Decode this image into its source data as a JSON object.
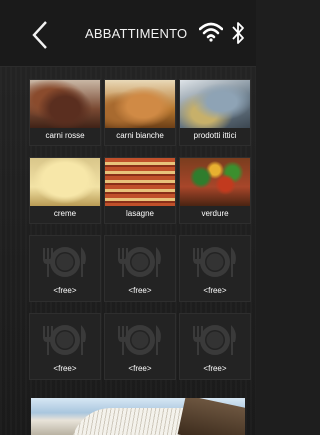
{
  "header": {
    "title": "ABBATTIMENTO",
    "back_icon": "chevron-left-icon",
    "wifi_icon": "wifi-icon",
    "bluetooth_icon": "bluetooth-icon"
  },
  "recipes": [
    {
      "label": "carni rosse",
      "image": "red-meat"
    },
    {
      "label": "carni bianche",
      "image": "roast-chicken"
    },
    {
      "label": "prodotti ittici",
      "image": "fish"
    },
    {
      "label": "creme",
      "image": "cream"
    },
    {
      "label": "lasagne",
      "image": "lasagna"
    },
    {
      "label": "verdure",
      "image": "vegetables"
    },
    {
      "label": "<free>",
      "image": "plate-cutlery-icon"
    },
    {
      "label": "<free>",
      "image": "plate-cutlery-icon"
    },
    {
      "label": "<free>",
      "image": "plate-cutlery-icon"
    },
    {
      "label": "<free>",
      "image": "plate-cutlery-icon"
    },
    {
      "label": "<free>",
      "image": "plate-cutlery-icon"
    },
    {
      "label": "<free>",
      "image": "plate-cutlery-icon"
    }
  ],
  "colors": {
    "background": "#1e1e1e",
    "header": "#1a1a1a",
    "text": "#ffffff"
  }
}
